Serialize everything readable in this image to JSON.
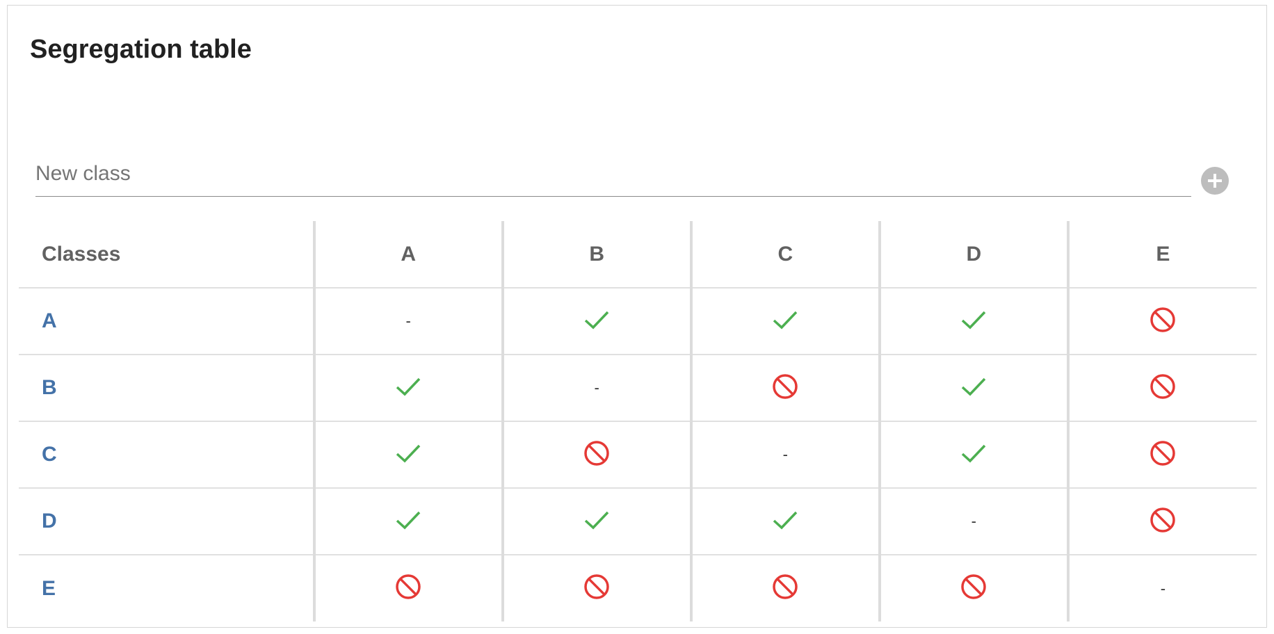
{
  "title": "Segregation table",
  "new_class_input": {
    "placeholder": "New class",
    "value": ""
  },
  "add_button": {
    "icon": "plus-icon"
  },
  "table": {
    "corner_header": "Classes",
    "columns": [
      "A",
      "B",
      "C",
      "D",
      "E"
    ],
    "rows": [
      {
        "label": "A",
        "cells": [
          "dash",
          "allowed",
          "allowed",
          "allowed",
          "forbidden"
        ]
      },
      {
        "label": "B",
        "cells": [
          "allowed",
          "dash",
          "forbidden",
          "allowed",
          "forbidden"
        ]
      },
      {
        "label": "C",
        "cells": [
          "allowed",
          "forbidden",
          "dash",
          "allowed",
          "forbidden"
        ]
      },
      {
        "label": "D",
        "cells": [
          "allowed",
          "allowed",
          "allowed",
          "dash",
          "forbidden"
        ]
      },
      {
        "label": "E",
        "cells": [
          "forbidden",
          "forbidden",
          "forbidden",
          "forbidden",
          "dash"
        ]
      }
    ],
    "dash_text": "-",
    "icons": {
      "allowed": "check-icon",
      "forbidden": "prohibited-icon"
    }
  },
  "colors": {
    "allowed": "#4caf50",
    "forbidden": "#e53935",
    "row_label": "#4472a8",
    "header_text": "#616161",
    "add_button": "#bdbdbd"
  }
}
